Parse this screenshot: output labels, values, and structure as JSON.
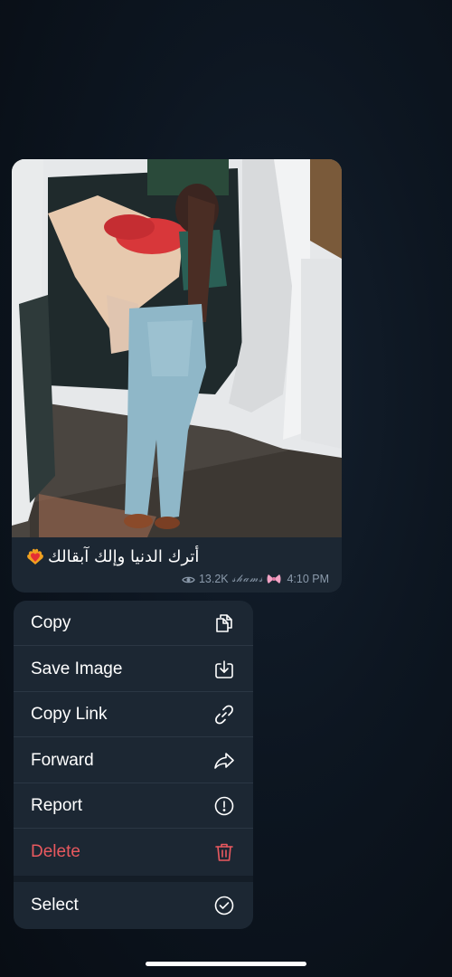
{
  "message": {
    "image_alt": "",
    "caption": "أترك الدنيا وإلك آبقالك",
    "caption_emoji": "heart-on-fire",
    "views": "13.2K",
    "signature": "𝓈𝒽𝒶𝓂𝓈",
    "time": "4:10 PM"
  },
  "menu": {
    "items": [
      {
        "label": "Copy",
        "icon": "copy-icon"
      },
      {
        "label": "Save Image",
        "icon": "download-icon"
      },
      {
        "label": "Copy Link",
        "icon": "link-icon"
      },
      {
        "label": "Forward",
        "icon": "forward-icon"
      },
      {
        "label": "Report",
        "icon": "report-icon"
      },
      {
        "label": "Delete",
        "icon": "trash-icon"
      },
      {
        "label": "Select",
        "icon": "check-circle-icon"
      }
    ]
  },
  "colors": {
    "background": "#0d1621",
    "panel": "#1c2733",
    "danger": "#e9595f",
    "meta": "#8b9aab"
  }
}
